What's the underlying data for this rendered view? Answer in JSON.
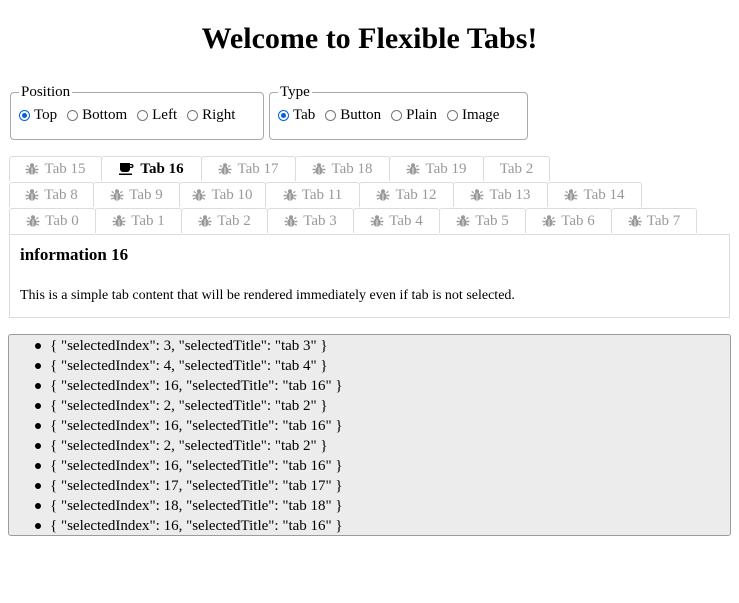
{
  "header": {
    "title": "Welcome to Flexible Tabs!"
  },
  "position_group": {
    "legend": "Position",
    "options": [
      {
        "label": "Top",
        "checked": true
      },
      {
        "label": "Bottom",
        "checked": false
      },
      {
        "label": "Left",
        "checked": false
      },
      {
        "label": "Right",
        "checked": false
      }
    ]
  },
  "type_group": {
    "legend": "Type",
    "options": [
      {
        "label": "Tab",
        "checked": true
      },
      {
        "label": "Button",
        "checked": false
      },
      {
        "label": "Plain",
        "checked": false
      },
      {
        "label": "Image",
        "checked": false
      }
    ]
  },
  "tab_rows": [
    [
      {
        "label": "Tab 15",
        "icon": "bug-icon"
      },
      {
        "label": "Tab 16",
        "icon": "coffee-icon",
        "active": true
      },
      {
        "label": "Tab 17",
        "icon": "bug-icon"
      },
      {
        "label": "Tab 18",
        "icon": "bug-icon"
      },
      {
        "label": "Tab 19",
        "icon": "bug-icon"
      },
      {
        "label": "Tab 2",
        "icon": ""
      }
    ],
    [
      {
        "label": "Tab 8",
        "icon": "bug-icon"
      },
      {
        "label": "Tab 9",
        "icon": "bug-icon"
      },
      {
        "label": "Tab 10",
        "icon": "bug-icon"
      },
      {
        "label": "Tab 11",
        "icon": "bug-icon"
      },
      {
        "label": "Tab 12",
        "icon": "bug-icon"
      },
      {
        "label": "Tab 13",
        "icon": "bug-icon"
      },
      {
        "label": "Tab 14",
        "icon": "bug-icon"
      }
    ],
    [
      {
        "label": "Tab 0",
        "icon": "bug-icon"
      },
      {
        "label": "Tab 1",
        "icon": "bug-icon"
      },
      {
        "label": "Tab 2",
        "icon": "bug-icon"
      },
      {
        "label": "Tab 3",
        "icon": "bug-icon"
      },
      {
        "label": "Tab 4",
        "icon": "bug-icon"
      },
      {
        "label": "Tab 5",
        "icon": "bug-icon"
      },
      {
        "label": "Tab 6",
        "icon": "bug-icon"
      },
      {
        "label": "Tab 7",
        "icon": "bug-icon"
      }
    ]
  ],
  "content": {
    "heading": "information 16",
    "text": "This is a simple tab content that will be rendered immediately even if tab is not selected."
  },
  "log": [
    "{ \"selectedIndex\": 3, \"selectedTitle\": \"tab 3\" }",
    "{ \"selectedIndex\": 4, \"selectedTitle\": \"tab 4\" }",
    "{ \"selectedIndex\": 16, \"selectedTitle\": \"tab 16\" }",
    "{ \"selectedIndex\": 2, \"selectedTitle\": \"tab 2\" }",
    "{ \"selectedIndex\": 16, \"selectedTitle\": \"tab 16\" }",
    "{ \"selectedIndex\": 2, \"selectedTitle\": \"tab 2\" }",
    "{ \"selectedIndex\": 16, \"selectedTitle\": \"tab 16\" }",
    "{ \"selectedIndex\": 17, \"selectedTitle\": \"tab 17\" }",
    "{ \"selectedIndex\": 18, \"selectedTitle\": \"tab 18\" }",
    "{ \"selectedIndex\": 16, \"selectedTitle\": \"tab 16\" }"
  ]
}
